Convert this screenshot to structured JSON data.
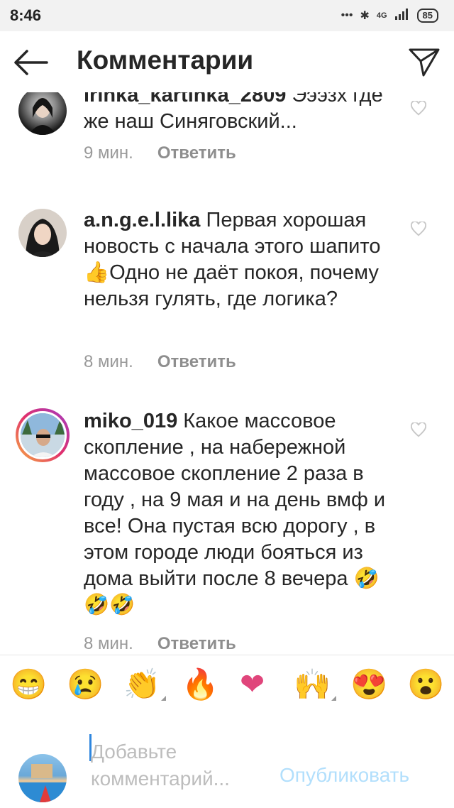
{
  "status_bar": {
    "time": "8:46",
    "network": "4G",
    "battery": "85"
  },
  "header": {
    "title": "Комментарии"
  },
  "comments": [
    {
      "username": "irinka_kartinka_2809",
      "text": "Эээзх где же наш Синяговский...",
      "time": "9 мин.",
      "reply_label": "Ответить"
    },
    {
      "username": "a.n.g.e.l.lika",
      "text": "Первая хорошая новость с начала этого шапито👍Одно не даёт покоя, почему нельзя гулять, где логика?",
      "time": "8 мин.",
      "reply_label": "Ответить"
    },
    {
      "username": "miko_019",
      "text": "Какое массовое скопление , на набережной массовое скопление 2 раза в году , на 9 мая и на день вмф и все! Она пустая всю дорогу , в этом городе люди бояться из дома выйти после 8 вечера 🤣🤣🤣",
      "time": "8 мин.",
      "reply_label": "Ответить"
    }
  ],
  "emoji_bar": [
    "😁",
    "😢",
    "👏",
    "🔥",
    "❤",
    "🙌",
    "😍",
    "😮"
  ],
  "composer": {
    "placeholder": "Добавьте комментарий...",
    "publish_label": "Опубликовать"
  },
  "colors": {
    "accent": "#b2dffc",
    "meta_gray": "#999999",
    "heart_gray": "#c7c7c7"
  }
}
